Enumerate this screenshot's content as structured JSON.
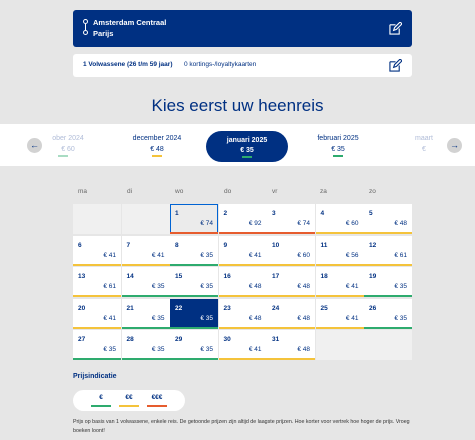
{
  "route": {
    "from": "Amsterdam Centraal",
    "to": "Parijs"
  },
  "passengers": {
    "main": "1 Volwassene (26 t/m 59 jaar)",
    "sub": "0 kortings-/loyaltykaarten"
  },
  "title": "Kies eerst uw heenreis",
  "months": [
    {
      "name": "ober 2024",
      "price": "€ 60",
      "tier": "cheap",
      "faded": true
    },
    {
      "name": "december 2024",
      "price": "€ 48",
      "tier": "mid",
      "faded": false
    },
    {
      "name": "januari 2025",
      "price": "€ 35",
      "tier": "cheap",
      "selected": true
    },
    {
      "name": "februari 2025",
      "price": "€ 35",
      "tier": "cheap",
      "faded": false
    },
    {
      "name": "maart",
      "price": "€",
      "tier": "cheap",
      "faded": true
    }
  ],
  "weekdays": [
    "ma",
    "di",
    "wo",
    "do",
    "vr",
    "za",
    "zo"
  ],
  "tier_colors": {
    "cheap": "#2eab6e",
    "mid": "#f4c33b",
    "high": "#e65c2e"
  },
  "weeks": [
    [
      null,
      null,
      {
        "day": "1",
        "price": "€ 74",
        "tier": "high",
        "state": "today"
      },
      {
        "day": "2",
        "price": "€ 92",
        "tier": "high"
      },
      {
        "day": "3",
        "price": "€ 74",
        "tier": "high"
      },
      {
        "day": "4",
        "price": "€ 60",
        "tier": "mid"
      },
      {
        "day": "5",
        "price": "€ 48",
        "tier": "mid"
      }
    ],
    [
      {
        "day": "6",
        "price": "€ 41",
        "tier": "mid"
      },
      {
        "day": "7",
        "price": "€ 41",
        "tier": "mid"
      },
      {
        "day": "8",
        "price": "€ 35",
        "tier": "cheap"
      },
      {
        "day": "9",
        "price": "€ 41",
        "tier": "mid"
      },
      {
        "day": "10",
        "price": "€ 60",
        "tier": "mid"
      },
      {
        "day": "11",
        "price": "€ 56",
        "tier": "mid"
      },
      {
        "day": "12",
        "price": "€ 61",
        "tier": "mid"
      }
    ],
    [
      {
        "day": "13",
        "price": "€ 61",
        "tier": "mid"
      },
      {
        "day": "14",
        "price": "€ 35",
        "tier": "cheap"
      },
      {
        "day": "15",
        "price": "€ 35",
        "tier": "cheap"
      },
      {
        "day": "16",
        "price": "€ 48",
        "tier": "mid"
      },
      {
        "day": "17",
        "price": "€ 48",
        "tier": "mid"
      },
      {
        "day": "18",
        "price": "€ 41",
        "tier": "mid"
      },
      {
        "day": "19",
        "price": "€ 35",
        "tier": "cheap"
      }
    ],
    [
      {
        "day": "20",
        "price": "€ 41",
        "tier": "mid"
      },
      {
        "day": "21",
        "price": "€ 35",
        "tier": "cheap"
      },
      {
        "day": "22",
        "price": "€ 35",
        "tier": "cheap",
        "state": "selected"
      },
      {
        "day": "23",
        "price": "€ 48",
        "tier": "mid"
      },
      {
        "day": "24",
        "price": "€ 48",
        "tier": "mid"
      },
      {
        "day": "25",
        "price": "€ 41",
        "tier": "mid"
      },
      {
        "day": "26",
        "price": "€ 35",
        "tier": "cheap"
      }
    ],
    [
      {
        "day": "27",
        "price": "€ 35",
        "tier": "cheap"
      },
      {
        "day": "28",
        "price": "€ 35",
        "tier": "cheap"
      },
      {
        "day": "29",
        "price": "€ 35",
        "tier": "cheap"
      },
      {
        "day": "30",
        "price": "€ 41",
        "tier": "mid"
      },
      {
        "day": "31",
        "price": "€ 48",
        "tier": "mid"
      },
      null,
      null
    ]
  ],
  "legend": {
    "title": "Prijsindicatie",
    "items": [
      {
        "label": "€",
        "tier": "cheap"
      },
      {
        "label": "€€",
        "tier": "mid"
      },
      {
        "label": "€€€",
        "tier": "high"
      }
    ]
  },
  "note": "Prijs op basis van 1 volwassene, enkele reis. De getoonde prijzen zijn altijd de laagste prijzen. Hoe korter voor vertrek hoe hoger de prijs. Vroeg boeken loont!"
}
